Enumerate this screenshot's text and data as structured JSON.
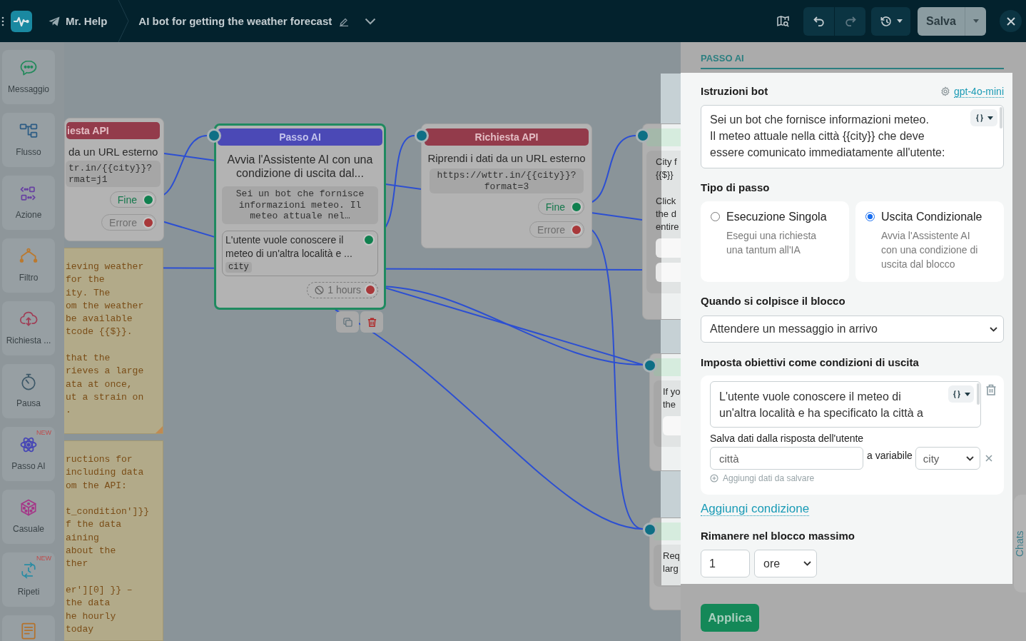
{
  "topbar": {
    "bot_name": "Mr. Help",
    "title": "AI bot for getting the weather forecast",
    "history_buttons": [
      {
        "kind": "undo",
        "disabled": false
      },
      {
        "kind": "redo",
        "disabled": true
      }
    ],
    "save": "Salva"
  },
  "toolbox": [
    {
      "label": "Messaggio",
      "kind": "message",
      "color": "#248a5c"
    },
    {
      "label": "Flusso",
      "kind": "flow",
      "color": "#2d5c84"
    },
    {
      "label": "Azione",
      "kind": "action",
      "color": "#6842a2"
    },
    {
      "label": "Filtro",
      "kind": "filter",
      "color": "#bb792e"
    },
    {
      "label": "Richiesta ...",
      "kind": "request",
      "color": "#a03e56"
    },
    {
      "label": "Pausa",
      "kind": "pause",
      "color": "#3d5868"
    },
    {
      "label": "Passo AI",
      "kind": "ai",
      "color": "#4646b6",
      "badge": "NEW"
    },
    {
      "label": "Casuale",
      "kind": "random",
      "color": "#a63688"
    },
    {
      "label": "Ripeti",
      "kind": "repeat",
      "color": "#2a8ca4",
      "badge": "NEW"
    },
    {
      "kind": "note",
      "color": "#b4722c"
    }
  ],
  "canvas": {
    "nodes": [
      {
        "kind": "api_request",
        "title": "iesta API",
        "description": "da un URL esterno",
        "code": "tr.in/{{city}}?\nrmat=j1",
        "selected": false,
        "outputs": [
          {
            "label": "Fine",
            "kind": "success",
            "color": "#10804f"
          },
          {
            "label": "Errore",
            "kind": "error",
            "color": "#a8383a"
          }
        ]
      },
      {
        "kind": "ai_step",
        "title": "Passo AI",
        "description": "Avvia l'Assistente AI con una condizione di uscita dal...",
        "code": "Sei un bot che fornisce informazioni meteo. Il meteo attuale nel…",
        "selected": true,
        "conditions": [
          {
            "text": "L'utente vuole conoscere il meteo di un'altra località e ...",
            "variable": "city",
            "color": "#10804f"
          }
        ],
        "timeout": {
          "label": "1 hours",
          "color": "#a8383a"
        }
      },
      {
        "kind": "api_request",
        "title": "Richiesta API",
        "description": "Riprendi i dati da un URL esterno",
        "code": "https://wttr.in/{{city}}?\nformat=3",
        "selected": false,
        "outputs": [
          {
            "label": "Fine",
            "kind": "success",
            "color": "#10804f"
          },
          {
            "label": "Errore",
            "kind": "error",
            "color": "#a8383a"
          }
        ]
      },
      {
        "kind": "partial",
        "selected": false,
        "paragraphs": [
          "City f\n{{$}}",
          "Click\nthe d\nentire"
        ],
        "fields": [
          {
            "kind": "input"
          },
          {
            "kind": "input"
          }
        ]
      },
      {
        "kind": "partial",
        "selected": false,
        "paragraphs": [
          "If yo\nthe"
        ],
        "fields": [
          {
            "kind": "input"
          }
        ]
      },
      {
        "kind": "partial",
        "selected": false,
        "paragraphs": [
          "Req\nlarg"
        ]
      }
    ],
    "notes": [
      {
        "text": "ieving weather\nfor the\nity. The\nom the weather\nbe available\ntcode {{$}}.\n\nthat the\nrieves a large\nata at once,\nut a strain on\n."
      },
      {
        "text": "ructions for\nincluding data\nom the API:\n\nt_condition']}}\nf the data\naining\nabout the\nther\n\ner'][0] }} –\nthe data\nhe hourly\ntoday"
      }
    ]
  },
  "panel": {
    "tab": "PASSO AI",
    "instructions": {
      "label": "Istruzioni bot",
      "model": "gpt-4o-mini",
      "value": "Sei un bot che fornisce informazioni meteo.\nIl meteo attuale nella città {{city}} che deve\nessere comunicato immediatamente all'utente:"
    },
    "step_type": {
      "label": "Tipo di passo",
      "options": [
        {
          "title": "Esecuzione Singola",
          "description": "Esegui una richiesta una tantum all'IA",
          "selected": false
        },
        {
          "title": "Uscita Condizionale",
          "description": "Avvia l'Assistente AI con una condizione di uscita dal blocco",
          "selected": true
        }
      ]
    },
    "trigger": {
      "label": "Quando si colpisce il blocco",
      "value": "Attendere un messaggio in arrivo"
    },
    "goals": {
      "label": "Imposta obiettivi come condizioni di uscita",
      "conditions": [
        {
          "value": "L'utente vuole conoscere il meteo di\nun'altra località e ha specificato la città a",
          "save_label": "Salva dati dalla risposta dell'utente",
          "saves": [
            {
              "field": "città",
              "joiner": "a variabile",
              "variable": "city"
            }
          ],
          "add_save": "Aggiungi dati da salvare"
        }
      ],
      "add_condition": "Aggiungi condizione"
    },
    "max_stay": {
      "label": "Rimanere nel blocco massimo",
      "value": "1",
      "unit": "ore"
    },
    "apply": "Applica",
    "side_tab": "Chats"
  }
}
